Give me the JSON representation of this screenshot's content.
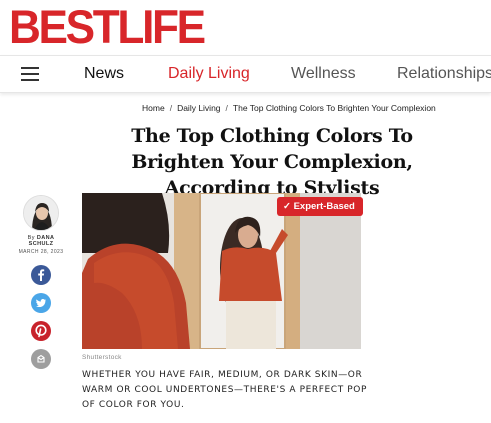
{
  "site": {
    "logo": "BESTLIFE",
    "brand_color": "#d8262a"
  },
  "nav": {
    "menu_icon": "hamburger-icon",
    "items": [
      {
        "label": "News",
        "active": false
      },
      {
        "label": "Daily Living",
        "active": true
      },
      {
        "label": "Wellness",
        "active": false
      },
      {
        "label": "Relationships",
        "active": false
      }
    ]
  },
  "breadcrumb": [
    {
      "label": "Home"
    },
    {
      "label": "Daily Living"
    },
    {
      "label": "The Top Clothing Colors To Brighten Your Complexion"
    }
  ],
  "article": {
    "title": "The Top Clothing Colors To Brighten Your Complexion, According to Stylists",
    "author_prefix": "By",
    "author": "DANA SCHULZ",
    "date": "MARCH 28, 2023",
    "badge": "✓ Expert-Based",
    "image_credit": "Shutterstock",
    "dek": "WHETHER YOU HAVE FAIR, MEDIUM, OR DARK SKIN—OR WARM OR COOL UNDERTONES—THERE'S A PERFECT POP OF COLOR FOR YOU."
  },
  "share": [
    {
      "network": "facebook",
      "icon": "facebook-icon",
      "color": "#3b5998"
    },
    {
      "network": "twitter",
      "icon": "twitter-icon",
      "color": "#4aa6e8"
    },
    {
      "network": "pinterest",
      "icon": "pinterest-icon",
      "color": "#c8232c"
    },
    {
      "network": "email",
      "icon": "email-icon",
      "color": "#9e9e9e"
    }
  ]
}
